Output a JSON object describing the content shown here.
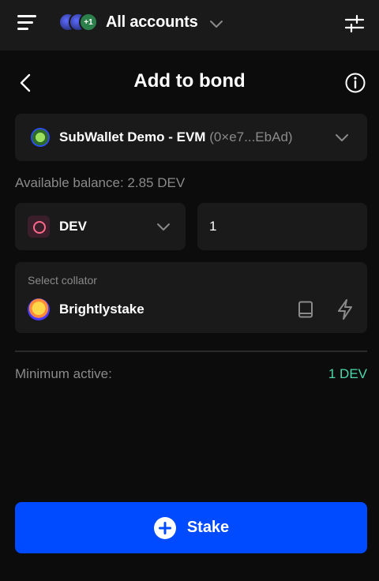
{
  "header": {
    "accounts_label": "All accounts",
    "accounts_badge": "+1"
  },
  "page": {
    "title": "Add to bond"
  },
  "account": {
    "name": "SubWallet Demo - EVM",
    "address": "(0×e7...EbAd)"
  },
  "balance": {
    "text": "Available balance: 2.85 DEV"
  },
  "token": {
    "symbol": "DEV"
  },
  "amount": {
    "value": "1"
  },
  "collator": {
    "label": "Select collator",
    "name": "Brightlystake"
  },
  "minimum": {
    "label": "Minimum active:",
    "value": "1 DEV"
  },
  "stake_button": {
    "label": "Stake"
  },
  "colors": {
    "background": "#0c0c0c",
    "card": "#1a1a1a",
    "primary": "#004bff",
    "success": "#4cd9ac",
    "muted_text": "#8a8a8a"
  },
  "icons": [
    "menu-icon",
    "chevron-down-icon",
    "settings-sliders-icon",
    "back-arrow-icon",
    "info-icon",
    "book-icon",
    "lightning-icon",
    "plus-circle-icon"
  ]
}
